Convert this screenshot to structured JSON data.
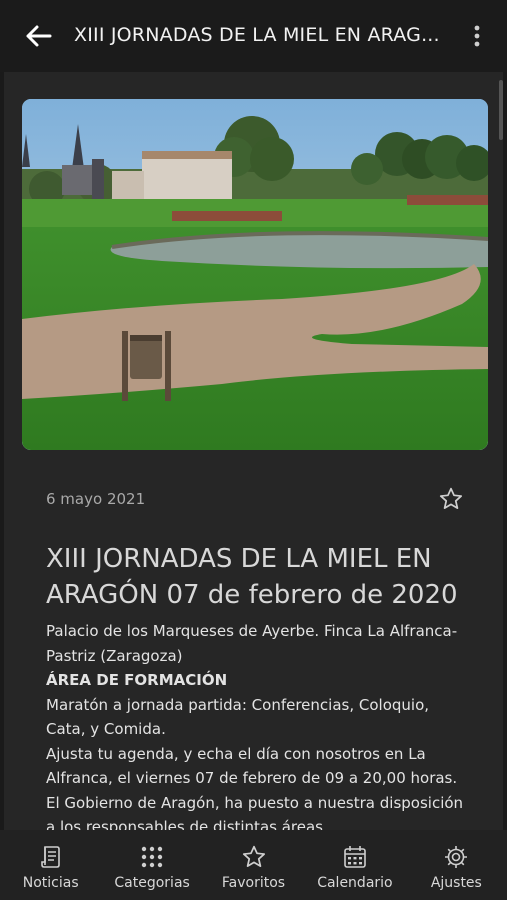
{
  "appbar": {
    "title": "XIII JORNADAS DE LA MIEL EN ARAG...",
    "back_icon": "arrow-left-icon",
    "more_icon": "more-vertical-icon"
  },
  "article": {
    "image_alt": "Jardines del Palacio de los Marqueses de Ayerbe con estanque y camino",
    "date": "6 mayo 2021",
    "favorite_icon": "star-outline-icon",
    "title": "XIII JORNADAS DE LA MIEL EN ARAGÓN 07 de febrero de 2020",
    "paragraphs": [
      "Palacio de los Marqueses de Ayerbe. Finca La Alfranca-Pastriz (Zaragoza)",
      "ÁREA DE FORMACIÓN",
      "Maratón a jornada partida: Conferencias, Coloquio, Cata, y Comida.",
      "Ajusta tu agenda, y echa el día con nosotros en La Alfranca, el viernes 07 de febrero de 09 a 20,00 horas.",
      "El Gobierno de Aragón, ha puesto a nuestra disposición a los responsables de distintas áreas"
    ]
  },
  "bottom_nav": {
    "items": [
      {
        "label": "Noticias",
        "icon": "news-icon"
      },
      {
        "label": "Categorias",
        "icon": "grid-dots-icon"
      },
      {
        "label": "Favoritos",
        "icon": "star-icon"
      },
      {
        "label": "Calendario",
        "icon": "calendar-icon"
      },
      {
        "label": "Ajustes",
        "icon": "gear-icon"
      }
    ]
  },
  "colors": {
    "background": "#1a1a1a",
    "surface": "#262626",
    "text": "#e3e3e3",
    "muted_text": "#a9a9a9"
  }
}
